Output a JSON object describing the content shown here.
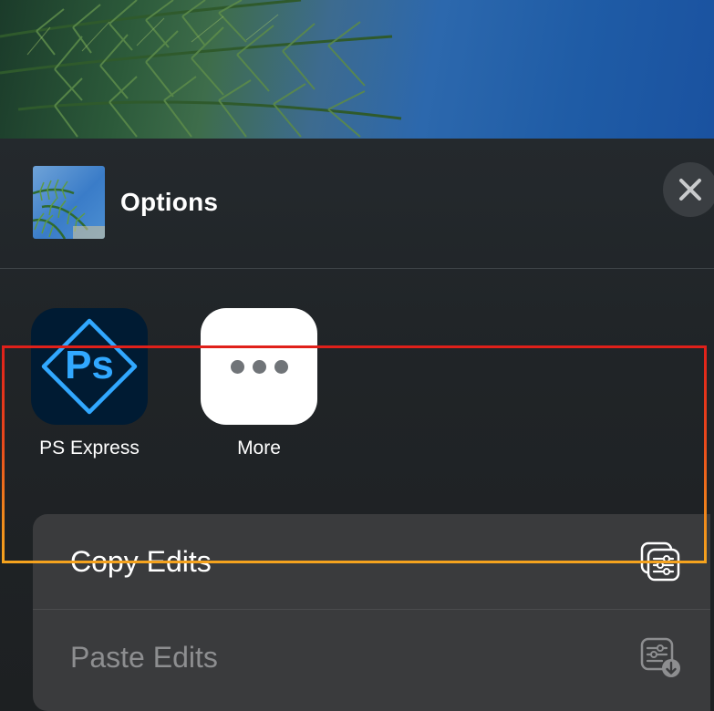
{
  "header": {
    "title": "Options",
    "thumbnail_icon": "photo-thumbnail",
    "close_icon": "close-icon"
  },
  "apps": [
    {
      "label": "PS Express",
      "icon": "ps-express-icon",
      "icon_text": "Ps"
    },
    {
      "label": "More",
      "icon": "more-dots-icon"
    }
  ],
  "actions": [
    {
      "label": "Copy Edits",
      "icon": "copy-edits-icon",
      "enabled": true
    },
    {
      "label": "Paste Edits",
      "icon": "paste-edits-icon",
      "enabled": false
    }
  ],
  "colors": {
    "highlight_top": "#e0201a",
    "highlight_bottom": "#f5a31e",
    "ps_accent": "#31a8ff",
    "ps_background": "#001b33"
  }
}
